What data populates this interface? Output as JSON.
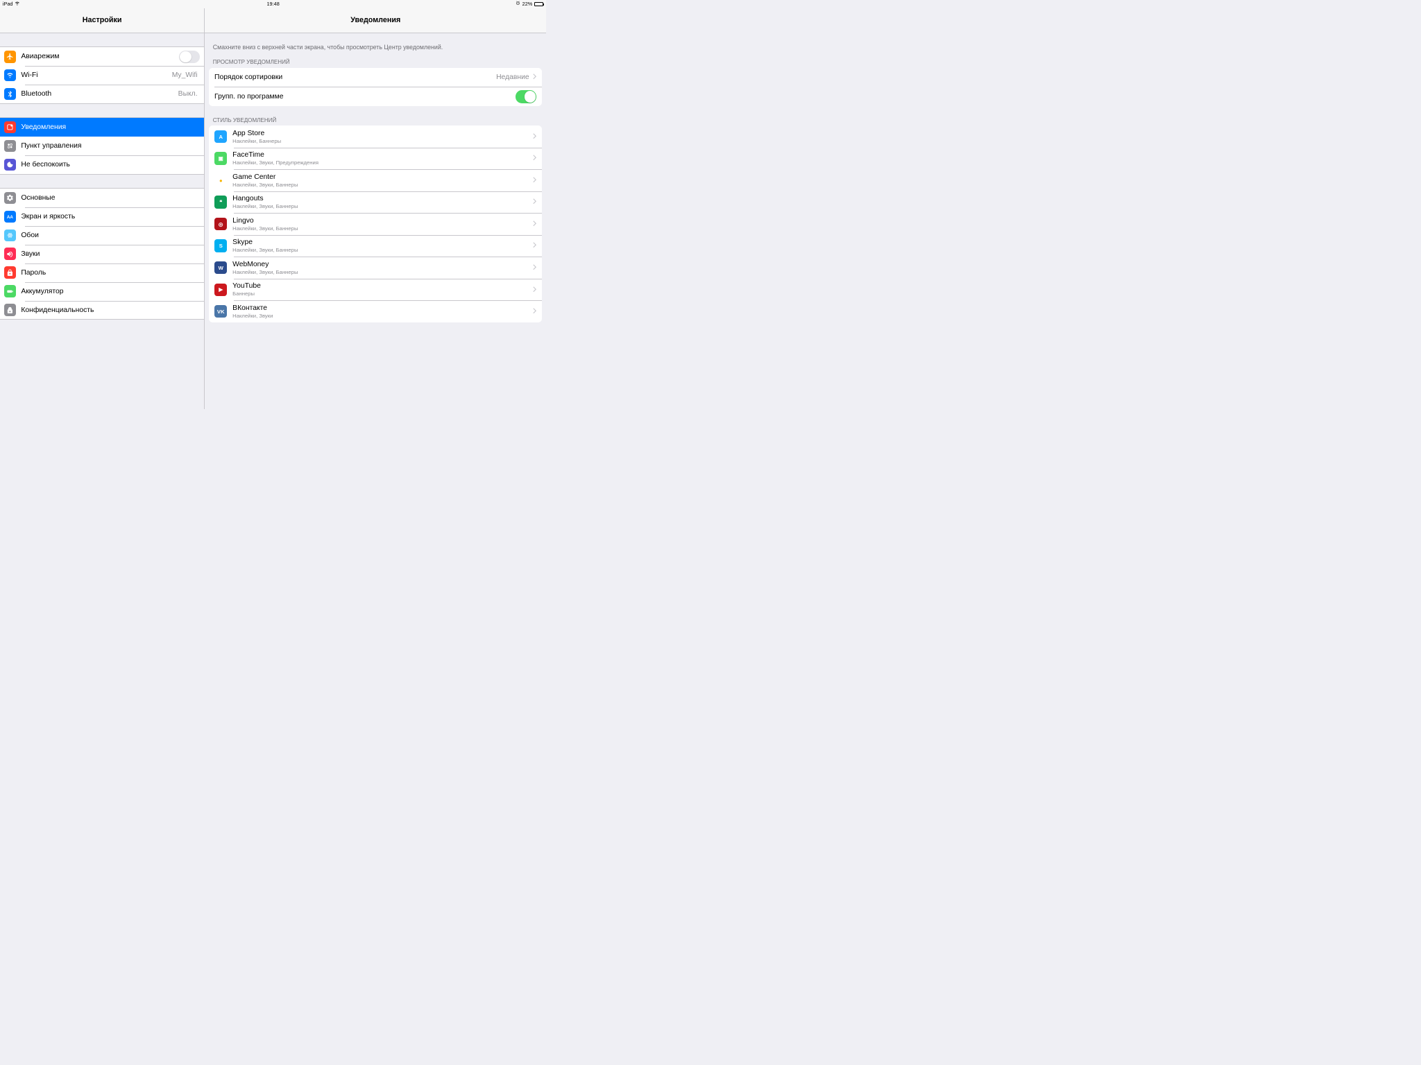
{
  "statusbar": {
    "device": "iPad",
    "time": "19:48",
    "battery": "22%"
  },
  "left": {
    "title": "Настройки",
    "group1": [
      {
        "icon": "airplane",
        "label": "Авиарежим",
        "toggle": false,
        "bg": "#ff9500"
      },
      {
        "icon": "wifi",
        "label": "Wi-Fi",
        "detail": "My_Wifi",
        "bg": "#007aff"
      },
      {
        "icon": "bluetooth",
        "label": "Bluetooth",
        "detail": "Выкл.",
        "bg": "#007aff"
      }
    ],
    "group2": [
      {
        "icon": "notifications",
        "label": "Уведомления",
        "bg": "#ff3b30",
        "selected": true
      },
      {
        "icon": "control-center",
        "label": "Пункт управления",
        "bg": "#8e8e93"
      },
      {
        "icon": "dnd",
        "label": "Не беспокоить",
        "bg": "#5856d6"
      }
    ],
    "group3": [
      {
        "icon": "general",
        "label": "Основные",
        "bg": "#8e8e93"
      },
      {
        "icon": "display",
        "label": "Экран и яркость",
        "bg": "#007aff"
      },
      {
        "icon": "wallpaper",
        "label": "Обои",
        "bg": "#54c7fc"
      },
      {
        "icon": "sounds",
        "label": "Звуки",
        "bg": "#ff2d55"
      },
      {
        "icon": "passcode",
        "label": "Пароль",
        "bg": "#ff3b30"
      },
      {
        "icon": "battery",
        "label": "Аккумулятор",
        "bg": "#4cd964"
      },
      {
        "icon": "privacy",
        "label": "Конфиденциальность",
        "bg": "#8e8e93"
      }
    ]
  },
  "right": {
    "title": "Уведомления",
    "desc": "Смахните вниз с верхней части экрана, чтобы просмотреть Центр уведомлений.",
    "sect1_header": "ПРОСМОТР УВЕДОМЛЕНИЙ",
    "sort": {
      "label": "Порядок сортировки",
      "detail": "Недавние"
    },
    "group": {
      "label": "Групп. по программе",
      "toggle": true
    },
    "sect2_header": "СТИЛЬ УВЕДОМЛЕНИЙ",
    "apps": [
      {
        "name": "App Store",
        "sub": "Наклейки, Баннеры",
        "bg": "#1fa5ff",
        "glyph": "A"
      },
      {
        "name": "FaceTime",
        "sub": "Наклейки, Звуки, Предупреждения",
        "bg": "#4cd964",
        "glyph": "▣"
      },
      {
        "name": "Game Center",
        "sub": "Наклейки, Звуки, Баннеры",
        "bg": "#ffffff",
        "glyph": "●",
        "fg": "#f7b500"
      },
      {
        "name": "Hangouts",
        "sub": "Наклейки, Звуки, Баннеры",
        "bg": "#0f9d58",
        "glyph": "❝"
      },
      {
        "name": "Lingvo",
        "sub": "Наклейки, Звуки, Баннеры",
        "bg": "#b2131a",
        "glyph": "◎"
      },
      {
        "name": "Skype",
        "sub": "Наклейки, Звуки, Баннеры",
        "bg": "#00aff0",
        "glyph": "S"
      },
      {
        "name": "WebMoney",
        "sub": "Наклейки, Звуки, Баннеры",
        "bg": "#2b4b8c",
        "glyph": "W"
      },
      {
        "name": "YouTube",
        "sub": "Баннеры",
        "bg": "#cc181e",
        "glyph": "▶"
      },
      {
        "name": "ВКонтакте",
        "sub": "Наклейки, Звуки",
        "bg": "#4a76a8",
        "glyph": "VK"
      }
    ]
  }
}
